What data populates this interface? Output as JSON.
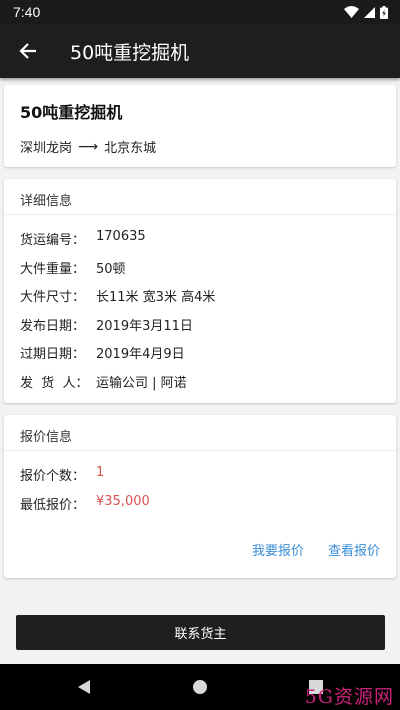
{
  "status_bar": {
    "time": "7:40"
  },
  "app_bar": {
    "title": "50吨重挖掘机"
  },
  "summary": {
    "cargo_name": "50吨重挖掘机",
    "origin": "深圳龙岗",
    "arrow": "⟶",
    "destination": "北京东城"
  },
  "details": {
    "header": "详细信息",
    "rows": [
      {
        "label": "货运编号：",
        "value": "170635"
      },
      {
        "label": "大件重量：",
        "value": "50顿"
      },
      {
        "label": "大件尺寸：",
        "value": "长11米 宽3米 高4米"
      },
      {
        "label": "发布日期：",
        "value": "2019年3月11日"
      },
      {
        "label": "过期日期：",
        "value": "2019年4月9日"
      },
      {
        "label": "发  货  人：",
        "value": "运输公司 | 阿诺"
      }
    ]
  },
  "quotes": {
    "header": "报价信息",
    "count_label": "报价个数：",
    "count_value": "1",
    "lowest_label": "最低报价：",
    "lowest_value": "¥35,000",
    "make_offer": "我要报价",
    "view_offers": "查看报价"
  },
  "contact_button": "联系货主",
  "watermark": "5G资源网",
  "colors": {
    "accent_red": "#d9534f",
    "link_blue": "#3a8fd6",
    "dark": "#1e1e1e"
  },
  "icons": [
    "wifi-icon",
    "signal-icon",
    "battery-icon",
    "back-arrow-icon",
    "nav-back-icon",
    "nav-home-icon",
    "nav-recents-icon"
  ]
}
